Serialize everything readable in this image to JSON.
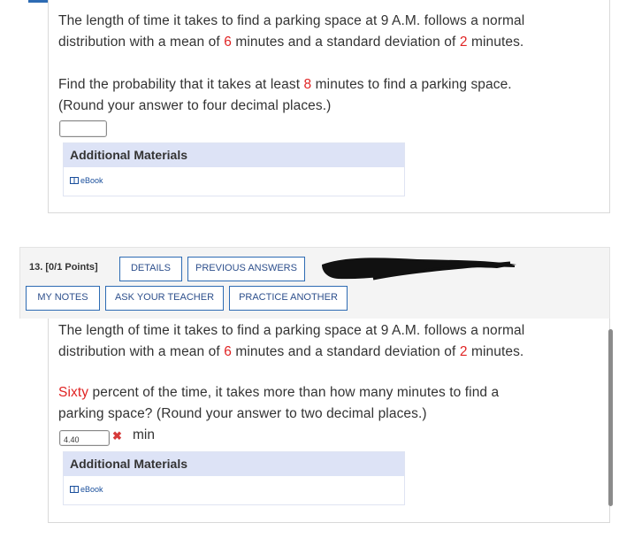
{
  "q12": {
    "text_1a": "The length of time it takes to find a parking space at 9 A.M. follows a normal",
    "text_1b_pre": "distribution with a mean of ",
    "mean": "6",
    "text_1b_mid": " minutes and a standard deviation of ",
    "sd": "2",
    "text_1b_post": " minutes.",
    "text_2a_pre": "Find the probability that it takes at least ",
    "threshold": "8",
    "text_2a_post": " minutes to find a parking space.",
    "text_2b": "(Round your answer to four decimal places.)",
    "answer_value": "",
    "additional_materials": "Additional Materials",
    "ebook": "eBook"
  },
  "q13": {
    "number": "13.",
    "points": "[0/1 Points]",
    "buttons": {
      "details": "DETAILS",
      "previous_answers": "PREVIOUS ANSWERS",
      "my_notes": "MY NOTES",
      "ask_teacher": "ASK YOUR TEACHER",
      "practice_another": "PRACTICE ANOTHER"
    },
    "text_1a": "The length of time it takes to find a parking space at 9 A.M. follows a normal",
    "text_1b_pre": "distribution with a mean of ",
    "mean": "6",
    "text_1b_mid": " minutes and a standard deviation of ",
    "sd": "2",
    "text_1b_post": " minutes.",
    "text_2a_red": "Sixty",
    "text_2a_post": " percent of the time, it takes more than how many minutes to find a",
    "text_2b": "parking space? (Round your answer to two decimal places.)",
    "answer_value": "4.40",
    "status_mark": "✖",
    "unit": "min",
    "additional_materials": "Additional Materials",
    "ebook": "eBook"
  },
  "colors": {
    "accent": "#2d6bb3",
    "highlight": "#e02424",
    "incorrect": "#d63a3a",
    "materials_header": "#dde3f6"
  }
}
